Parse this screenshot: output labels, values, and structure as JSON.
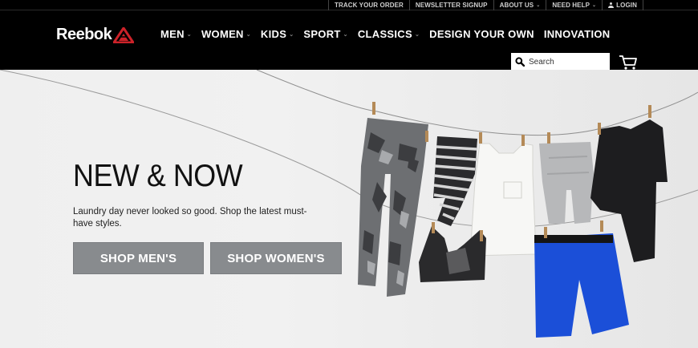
{
  "utility_nav": {
    "items": [
      {
        "label": "TRACK YOUR ORDER"
      },
      {
        "label": "NEWSLETTER SIGNUP"
      },
      {
        "label": "ABOUT US",
        "dropdown": true
      },
      {
        "label": "NEED HELP",
        "dropdown": true
      },
      {
        "label": "LOGIN",
        "icon": "user-icon"
      }
    ]
  },
  "brand": {
    "name": "Reebok",
    "logo_icon": "reebok-delta-icon",
    "accent": "#cc2229"
  },
  "main_nav": {
    "items": [
      {
        "label": "MEN",
        "dropdown": true
      },
      {
        "label": "WOMEN",
        "dropdown": true
      },
      {
        "label": "KIDS",
        "dropdown": true
      },
      {
        "label": "SPORT",
        "dropdown": true
      },
      {
        "label": "CLASSICS",
        "dropdown": true
      },
      {
        "label": "DESIGN YOUR OWN",
        "dropdown": false
      },
      {
        "label": "INNOVATION",
        "dropdown": false
      }
    ]
  },
  "search": {
    "placeholder": "Search",
    "icon": "search-icon"
  },
  "cart": {
    "icon": "cart-icon"
  },
  "hero": {
    "headline": "NEW & NOW",
    "subcopy": "Laundry day never looked so good. Shop the latest must-have styles.",
    "buttons": {
      "men": "SHOP MEN'S",
      "women": "SHOP WOMEN'S"
    },
    "button_color": "#888b8e"
  }
}
